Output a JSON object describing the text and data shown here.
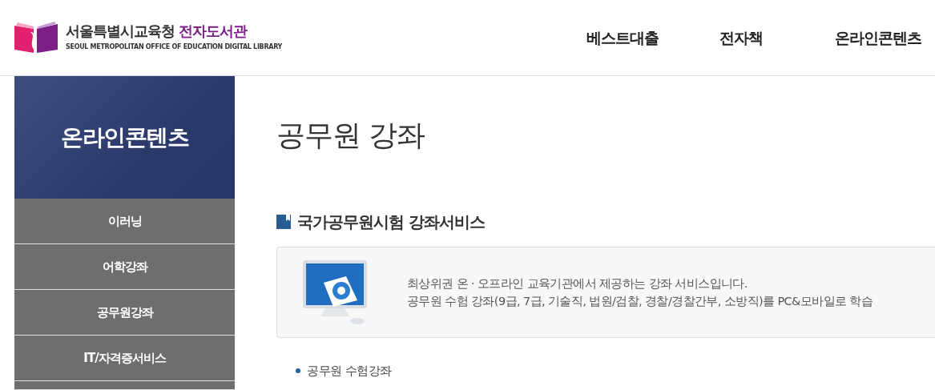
{
  "header": {
    "logo_title": "서울특별시교육청",
    "logo_title_accent": "전자도서관",
    "logo_subtitle": "SEOUL METROPOLITAN OFFICE OF EDUCATION DIGITAL LIBRARY",
    "nav": [
      "베스트대출",
      "전자책",
      "온라인콘텐츠"
    ]
  },
  "sidebar": {
    "title": "온라인콘텐츠",
    "items": [
      "이러닝",
      "어학강좌",
      "공무원강좌",
      "IT/자격증서비스"
    ]
  },
  "main": {
    "title": "공무원 강좌",
    "section_title": "국가공무원시험 강좌서비스",
    "info_lines": [
      "최상위권 온 · 오프라인 교육기관에서 제공하는 강좌 서비스입니다.",
      "공무원 수험 강좌(9급, 7급, 기술직, 법원/검찰, 경찰/경찰간부, 소방직)를 PC&모바일로 학습"
    ],
    "links": [
      "공무원 수험강좌"
    ]
  }
}
